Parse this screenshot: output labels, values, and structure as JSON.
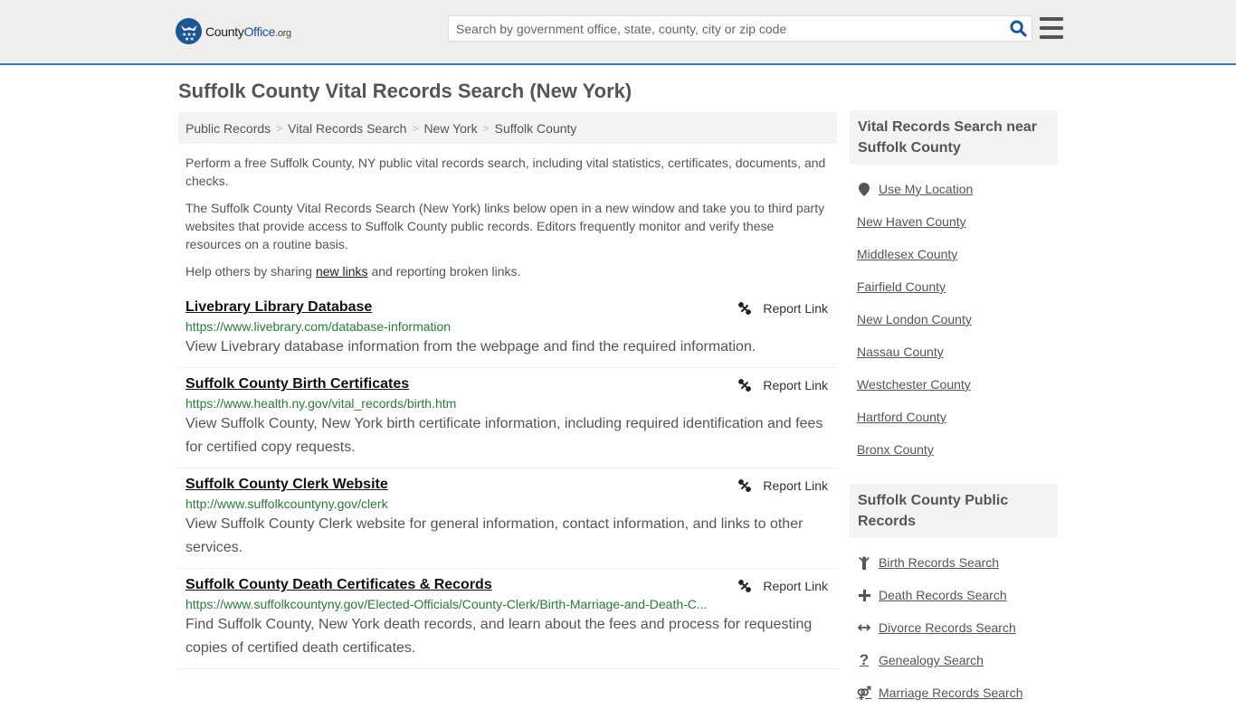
{
  "header": {
    "logo": {
      "county": "County",
      "office": "Office",
      "org": ".org"
    },
    "search_placeholder": "Search by government office, state, county, city or zip code",
    "brand_color": "#1c5694",
    "accent_border": "#3a7aa8"
  },
  "page_title": "Suffolk County Vital Records Search (New York)",
  "breadcrumb": [
    {
      "label": "Public Records"
    },
    {
      "label": "Vital Records Search"
    },
    {
      "label": "New York"
    },
    {
      "label": "Suffolk County"
    }
  ],
  "intro": {
    "p1": "Perform a free Suffolk County, NY public vital records search, including vital statistics, certificates, documents, and checks.",
    "p2": "The Suffolk County Vital Records Search (New York) links below open in a new window and take you to third party websites that provide access to Suffolk County public records. Editors frequently monitor and verify these resources on a routine basis.",
    "p3_before": "Help others by sharing ",
    "p3_link": "new links",
    "p3_after": " and reporting broken links."
  },
  "report_label": "Report Link",
  "links": [
    {
      "title": "Livebrary Library Database",
      "url": "https://www.livebrary.com/database-information",
      "desc": "View Livebrary database information from the webpage and find the required information."
    },
    {
      "title": "Suffolk County Birth Certificates",
      "url": "https://www.health.ny.gov/vital_records/birth.htm",
      "desc": "View Suffolk County, New York birth certificate information, including required identification and fees for certified copy requests."
    },
    {
      "title": "Suffolk County Clerk Website",
      "url": "http://www.suffolkcountyny.gov/clerk",
      "desc": "View Suffolk County Clerk website for general information, contact information, and links to other services."
    },
    {
      "title": "Suffolk County Death Certificates & Records",
      "url": "https://www.suffolkcountyny.gov/Elected-Officials/County-Clerk/Birth-Marriage-and-Death-C...",
      "desc": "Find Suffolk County, New York death records, and learn about the fees and process for requesting copies of certified death certificates."
    }
  ],
  "sidebar": {
    "nearby_heading": "Vital Records Search near Suffolk County",
    "use_location": "Use My Location",
    "nearby": [
      "New Haven County",
      "Middlesex County",
      "Fairfield County",
      "New London County",
      "Nassau County",
      "Westchester County",
      "Hartford County",
      "Bronx County"
    ],
    "public_heading": "Suffolk County Public Records",
    "public_records": [
      {
        "label": "Birth Records Search",
        "icon": "child-icon"
      },
      {
        "label": "Death Records Search",
        "icon": "cross-icon"
      },
      {
        "label": "Divorce Records Search",
        "icon": "arrows-horizontal-icon"
      },
      {
        "label": "Genealogy Search",
        "icon": "question-icon"
      },
      {
        "label": "Marriage Records Search",
        "icon": "marriage-icon"
      }
    ]
  }
}
